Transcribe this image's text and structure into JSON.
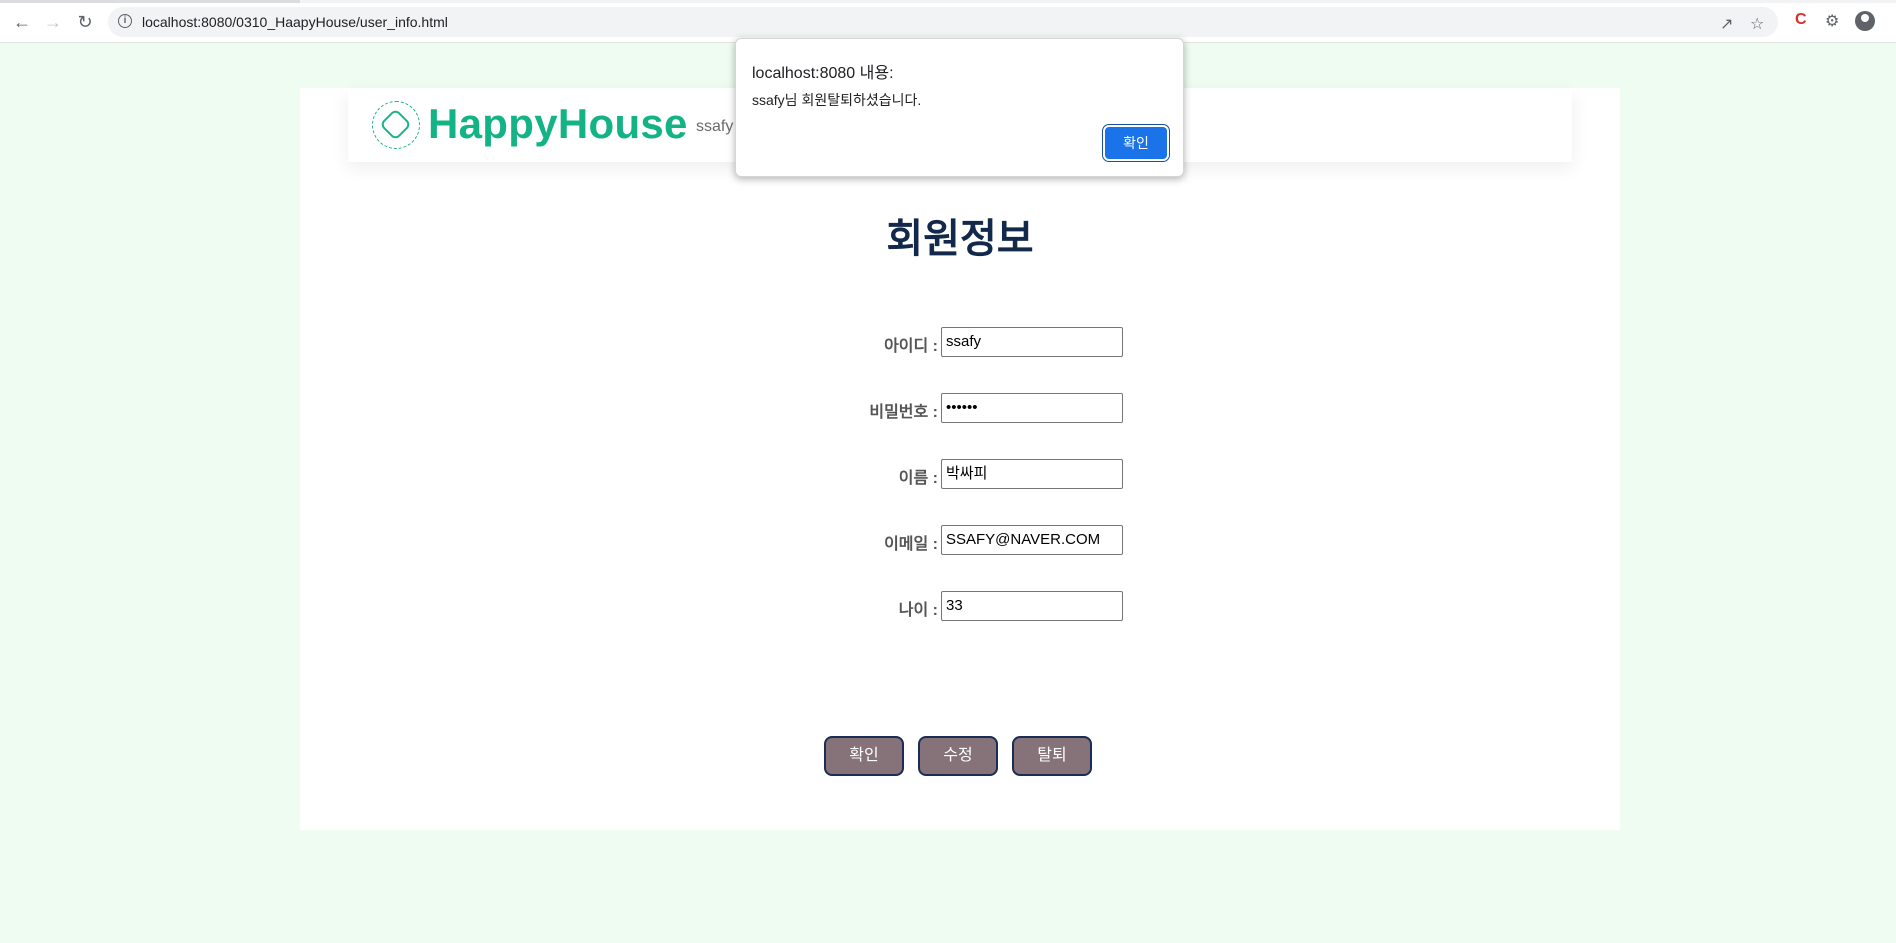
{
  "browser": {
    "url": "localhost:8080/0310_HaapyHouse/user_info.html",
    "icons": [
      "back-icon",
      "forward-icon",
      "reload-icon",
      "info-icon",
      "share-icon",
      "star-icon",
      "extension-c-icon",
      "puzzle-icon",
      "profile-icon"
    ]
  },
  "header": {
    "logo_text": "HappyHouse",
    "user": "ssafy"
  },
  "page": {
    "title": "회원정보"
  },
  "form": {
    "fields": [
      {
        "label": "아이디 :",
        "value": "ssafy"
      },
      {
        "label": "비밀번호 :",
        "value": "••••••"
      },
      {
        "label": "이름 :",
        "value": "박싸피"
      },
      {
        "label": "이메일 :",
        "value": "SSAFY@NAVER.COM"
      },
      {
        "label": "나이 :",
        "value": "33"
      }
    ]
  },
  "buttons": {
    "confirm": "확인",
    "edit": "수정",
    "withdraw": "탈퇴"
  },
  "dialog": {
    "title": "localhost:8080 내용:",
    "message": "ssafy님 회원탈퇴하셨습니다.",
    "ok": "확인"
  },
  "colors": {
    "page_bg": "#effcf2",
    "brand": "#14b386",
    "title": "#13294b",
    "button_bg": "#857379",
    "button_border": "#1b2c55",
    "dialog_button": "#1a73e8"
  }
}
